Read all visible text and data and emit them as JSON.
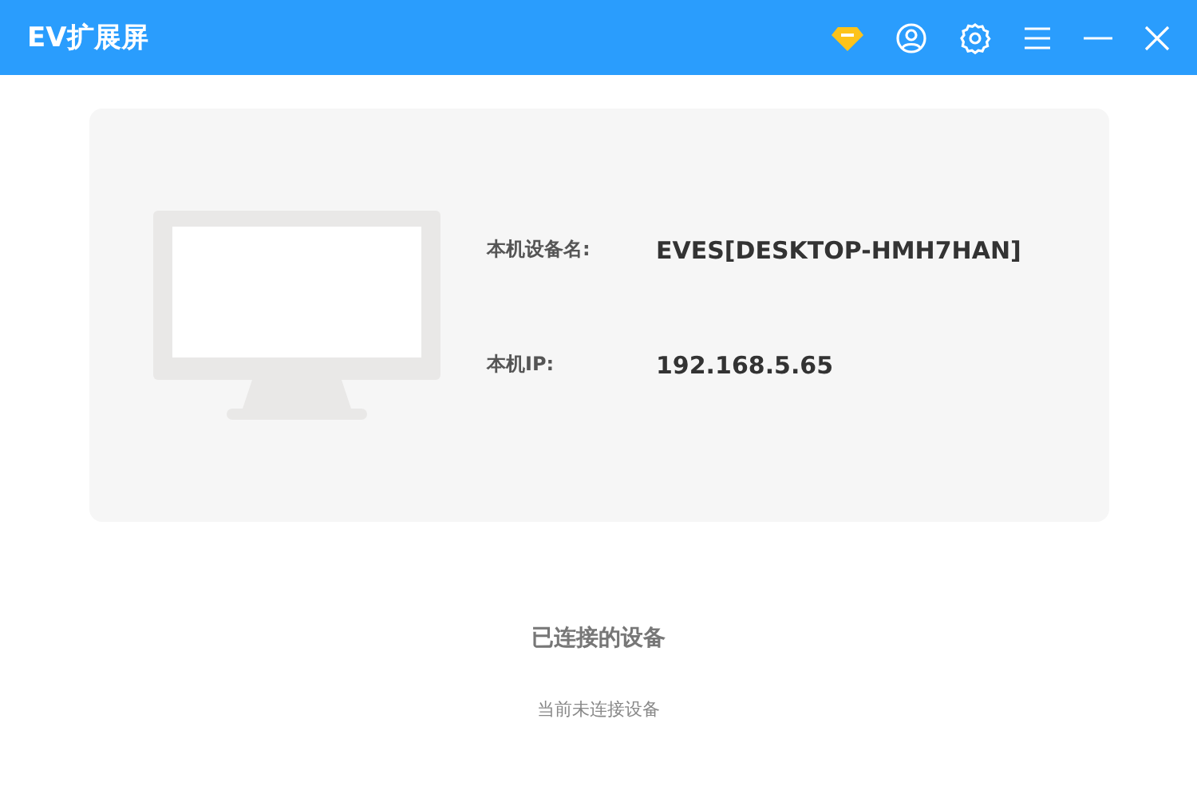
{
  "window": {
    "title": "EV扩展屏"
  },
  "device": {
    "fields": [
      {
        "label": "本机设备名:",
        "value": "EVES[DESKTOP-HMH7HAN]"
      },
      {
        "label": "本机IP:",
        "value": "192.168.5.65"
      }
    ]
  },
  "connected": {
    "heading": "已连接的设备",
    "empty_text": "当前未连接设备"
  }
}
